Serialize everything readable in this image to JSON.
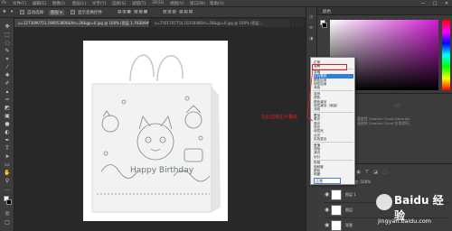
{
  "menu": [
    "文件(F)",
    "编辑(E)",
    "图像(I)",
    "图层(L)",
    "文字(Y)",
    "选择(S)",
    "滤镜(T)",
    "3D(D)",
    "视图(V)",
    "窗口(W)",
    "帮助(H)"
  ],
  "window_controls": [
    "—",
    "□",
    "✕"
  ],
  "options": {
    "auto_select_label": "自动选择:",
    "show_transform_label": "显示变换控件"
  },
  "tabs": [
    {
      "label": "u=1273090751,196953806&fm=26&gp=0.jpg @ 100% (图层 1, RGB/8#) *"
    },
    {
      "label": "u=7561787754,16218486m=26&gp=0.jpg @ 100% (图层..."
    }
  ],
  "tools": [
    "move-tool",
    "marquee-tool",
    "lasso-tool",
    "quick-select-tool",
    "crop-tool",
    "eyedropper-tool",
    "healing-tool",
    "brush-tool",
    "stamp-tool",
    "history-brush-tool",
    "eraser-tool",
    "gradient-tool",
    "blur-tool",
    "dodge-tool",
    "pen-tool",
    "type-tool",
    "path-select-tool",
    "shape-tool",
    "hand-tool",
    "zoom-tool",
    "more-tools",
    "color-swatches",
    "quick-mask",
    "screen-mode"
  ],
  "color_panel": {
    "title": "颜色"
  },
  "blend_modes": [
    {
      "label": "正常",
      "selected": false
    },
    {
      "label": "溶解",
      "selected": false
    },
    {
      "sep": true
    },
    {
      "label": "变暗",
      "selected": false
    },
    {
      "label": "正片叠底",
      "selected": true
    },
    {
      "label": "颜色加深",
      "selected": false
    },
    {
      "label": "线性加深",
      "selected": false
    },
    {
      "label": "深色",
      "selected": false
    },
    {
      "sep": true
    },
    {
      "label": "变亮",
      "selected": false
    },
    {
      "label": "滤色",
      "selected": false
    },
    {
      "label": "颜色减淡",
      "selected": false
    },
    {
      "label": "线性减淡（添加）",
      "selected": false
    },
    {
      "label": "浅色",
      "selected": false
    },
    {
      "sep": true
    },
    {
      "label": "叠加",
      "selected": false
    },
    {
      "label": "柔光",
      "selected": false
    },
    {
      "label": "强光",
      "selected": false
    },
    {
      "label": "亮光",
      "selected": false
    },
    {
      "label": "线性光",
      "selected": false
    },
    {
      "label": "点光",
      "selected": false
    },
    {
      "label": "实色混合",
      "selected": false
    },
    {
      "sep": true
    },
    {
      "label": "差值",
      "selected": false
    },
    {
      "label": "排除",
      "selected": false
    },
    {
      "label": "减去",
      "selected": false
    },
    {
      "label": "划分",
      "selected": false
    },
    {
      "sep": true
    },
    {
      "label": "色相",
      "selected": false
    },
    {
      "label": "饱和度",
      "selected": false
    },
    {
      "label": "颜色",
      "selected": false
    },
    {
      "label": "明度",
      "selected": false
    }
  ],
  "libraries": {
    "line1": "要使用 Creative Cloud Libraries,",
    "line2": "请安装 Creative Cloud 应用程序。"
  },
  "layers": {
    "blend_value": "正常",
    "opacity_label": "不透明度:",
    "opacity_value": "100%",
    "rows": [
      {
        "name": "图层 1"
      },
      {
        "name": "图层"
      },
      {
        "name": "背景"
      }
    ]
  },
  "annotation": {
    "text": "在此选择正片叠底",
    "color": "#e02020"
  },
  "watermark": {
    "brand": "Baidu 经验",
    "url": "jingyan.baidu.com"
  },
  "document": {
    "bag_text": "Happy Birthday"
  }
}
